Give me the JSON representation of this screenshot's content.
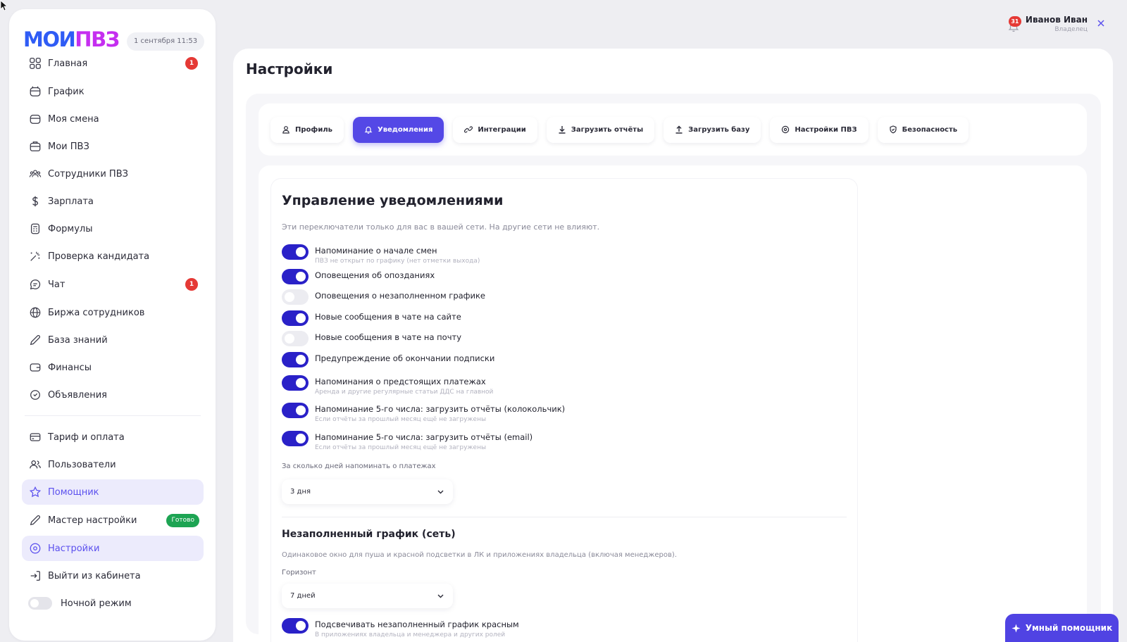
{
  "brand": {
    "logo_part1": "МОИ",
    "logo_part2": "ПВЗ",
    "color_blue": "#2f5cf5",
    "color_pink": "#c52ef0"
  },
  "date_chip": "1 сентября 11:53",
  "sidebar": {
    "items": [
      {
        "label": "Главная",
        "icon": "grid-icon",
        "badge": "1"
      },
      {
        "label": "График",
        "icon": "calendar-icon"
      },
      {
        "label": "Моя смена",
        "icon": "shift-icon"
      },
      {
        "label": "Мои ПВЗ",
        "icon": "store-icon"
      },
      {
        "label": "Сотрудники ПВЗ",
        "icon": "team-icon"
      },
      {
        "label": "Зарплата",
        "icon": "dollar-icon"
      },
      {
        "label": "Формулы",
        "icon": "formula-icon"
      },
      {
        "label": "Проверка кандидата",
        "icon": "sparkle-icon"
      },
      {
        "label": "Чат",
        "icon": "chat-icon",
        "badge": "1"
      },
      {
        "label": "Биржа сотрудников",
        "icon": "globe-icon"
      },
      {
        "label": "База знаний",
        "icon": "pencil-icon"
      },
      {
        "label": "Финансы",
        "icon": "wallet-icon"
      },
      {
        "label": "Объявления",
        "icon": "announce-icon"
      },
      {
        "label": "Тариф и оплата",
        "icon": "card-icon"
      },
      {
        "label": "Пользователи",
        "icon": "users-icon"
      },
      {
        "label": "Помощник",
        "icon": "star-icon"
      },
      {
        "label": "Мастер настройки",
        "icon": "wand-icon",
        "pill": "Готово"
      },
      {
        "label": "Настройки",
        "icon": "settings-icon"
      },
      {
        "label": "Выйти из кабинета",
        "icon": "logout-icon"
      }
    ],
    "night_mode_label": "Ночной режим"
  },
  "user": {
    "name": "Иванов Иван",
    "role": "Владелец",
    "notifications": "31"
  },
  "page_title": "Настройки",
  "tabs": [
    {
      "label": "Профиль",
      "icon": "user-icon"
    },
    {
      "label": "Уведомления",
      "icon": "bell-icon",
      "active": true
    },
    {
      "label": "Интеграции",
      "icon": "link-icon"
    },
    {
      "label": "Загрузить отчёты",
      "icon": "download-icon"
    },
    {
      "label": "Загрузить базу",
      "icon": "upload-icon"
    },
    {
      "label": "Настройки ПВЗ",
      "icon": "gear-icon"
    },
    {
      "label": "Безопасность",
      "icon": "shield-icon"
    }
  ],
  "notifications_card": {
    "title": "Управление уведомлениями",
    "subtitle": "Эти переключатели только для вас в вашей сети. На другие сети не влияют.",
    "toggles": [
      {
        "label": "Напоминание о начале смен",
        "hint": "ПВЗ не открыт по графику (нет отметки выхода)",
        "on": true
      },
      {
        "label": "Оповещения об опозданиях",
        "hint": "",
        "on": true
      },
      {
        "label": "Оповещения о незаполненном графике",
        "hint": "",
        "on": false
      },
      {
        "label": "Новые сообщения в чате на сайте",
        "hint": "",
        "on": true
      },
      {
        "label": "Новые сообщения в чате на почту",
        "hint": "",
        "on": false
      },
      {
        "label": "Предупреждение об окончании подписки",
        "hint": "",
        "on": true
      },
      {
        "label": "Напоминания о предстоящих платежах",
        "hint": "Аренда и другие регулярные статьи ДДС на главной",
        "on": true
      },
      {
        "label": "Напоминание 5-го числа: загрузить отчёты (колокольчик)",
        "hint": "Если отчёты за прошлый месяц ещё не загружены",
        "on": true
      },
      {
        "label": "Напоминание 5-го числа: загрузить отчёты (email)",
        "hint": "Если отчёты за прошлый месяц ещё не загружены",
        "on": true
      }
    ],
    "payment_days": {
      "label": "За сколько дней напоминать о платежах",
      "value": "3 дня"
    },
    "schedule_section": {
      "title": "Незаполненный график (сеть)",
      "subtitle": "Одинаковое окно для пуша и красной подсветки в ЛК и приложениях владельца (включая менеджеров).",
      "horizon_label": "Горизонт",
      "horizon_value": "7 дней",
      "highlight_toggle": {
        "label": "Подсвечивать незаполненный график красным",
        "hint": "В приложениях владельца и менеджера и других ролей",
        "on": true
      }
    }
  },
  "assistant_button": "Умный помощник",
  "colors": {
    "accent": "#5448e6",
    "toggle_on": "#2a21c8",
    "badge_red": "#e53935",
    "ready_green": "#1da453"
  }
}
